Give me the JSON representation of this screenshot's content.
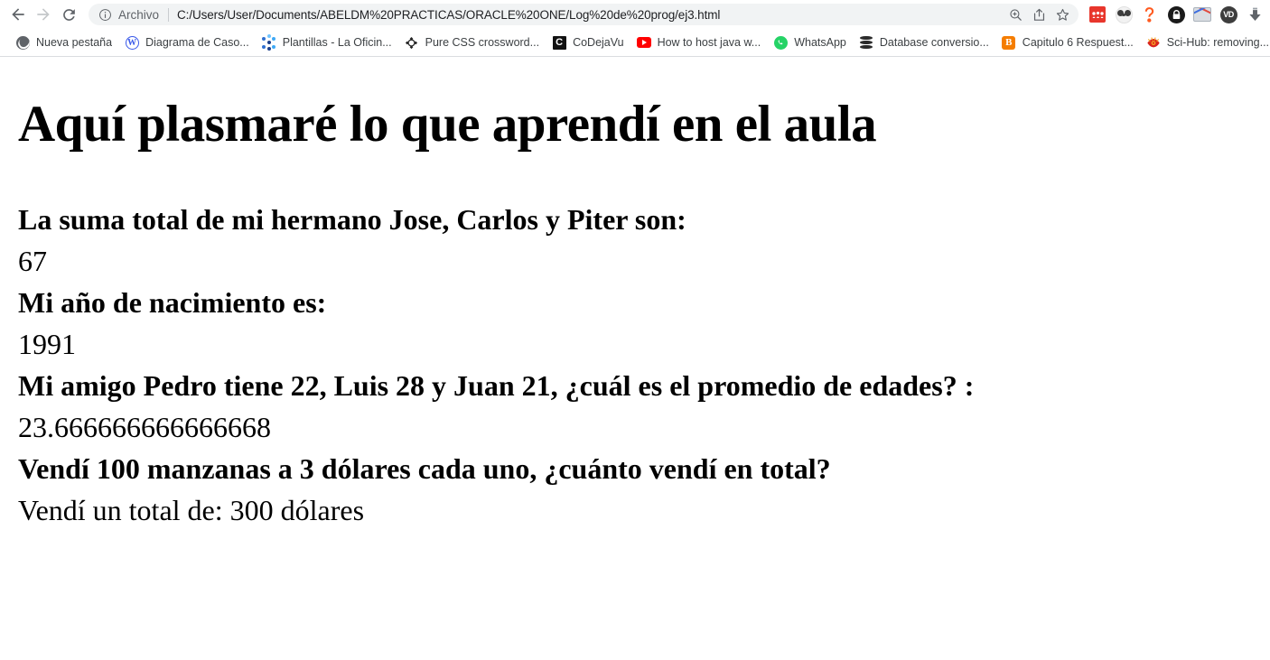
{
  "browser": {
    "nav": {
      "back_label": "Back",
      "forward_label": "Forward",
      "reload_label": "Reload"
    },
    "omnibox": {
      "scheme_label": "Archivo",
      "url": "C:/Users/User/Documents/ABELDM%20PRACTICAS/ORACLE%20ONE/Log%20de%20prog/ej3.html",
      "info_icon": "info-circle-icon",
      "actions": [
        {
          "name": "zoom-in-icon",
          "label": "Zoom"
        },
        {
          "name": "share-icon",
          "label": "Share this page"
        },
        {
          "name": "bookmark-star-icon",
          "label": "Bookmark this tab"
        }
      ]
    },
    "extensions": [
      {
        "name": "mendeley-extension-icon",
        "label": "Mendeley Web Importer"
      },
      {
        "name": "panda-extension-icon",
        "label": "Panda"
      },
      {
        "name": "keeper-extension-icon",
        "label": "Keeper Password Manager"
      },
      {
        "name": "adblock-extension-icon",
        "label": "AdBlock"
      },
      {
        "name": "mail-extension-icon",
        "label": "Mail"
      },
      {
        "name": "vd-extension-icon",
        "label": "Video DownloadHelper"
      },
      {
        "name": "downloads-icon",
        "label": "Downloads"
      }
    ],
    "bookmarks": [
      {
        "label": "Nueva pestaña",
        "favicon": "globe-favicon"
      },
      {
        "label": "Diagrama de Caso...",
        "favicon": "wordpress-favicon"
      },
      {
        "label": "Plantillas - La Oficin...",
        "favicon": "dots-favicon"
      },
      {
        "label": "Pure CSS crossword...",
        "favicon": "css-badge-favicon"
      },
      {
        "label": "CoDejaVu",
        "favicon": "codejavu-favicon"
      },
      {
        "label": "How to host java w...",
        "favicon": "youtube-favicon"
      },
      {
        "label": "WhatsApp",
        "favicon": "whatsapp-favicon"
      },
      {
        "label": "Database conversio...",
        "favicon": "database-favicon"
      },
      {
        "label": "Capitulo 6 Respuest...",
        "favicon": "blogger-favicon"
      },
      {
        "label": "Sci-Hub: removing...",
        "favicon": "scihub-favicon"
      },
      {
        "label": "C",
        "favicon": "tree-favicon"
      }
    ]
  },
  "page": {
    "title": "Aquí plasmaré lo que aprendí en el aula",
    "entries": [
      {
        "question": "La suma total de mi hermano Jose, Carlos y Piter son:",
        "answer": "67"
      },
      {
        "question": "Mi año de nacimiento es:",
        "answer": "1991"
      },
      {
        "question": "Mi amigo Pedro tiene 22, Luis 28 y Juan 21, ¿cuál es el promedio de edades? :",
        "answer": "23.666666666666668"
      },
      {
        "question": "Vendí 100 manzanas a 3 dólares cada uno, ¿cuánto vendí en total?",
        "answer": "Vendí un total de: 300 dólares"
      }
    ]
  },
  "colors": {
    "chrome_bg": "#ffffff",
    "omnibox_bg": "#f1f3f4",
    "text_primary": "#202124",
    "text_secondary": "#5f6368",
    "page_text": "#000000"
  }
}
